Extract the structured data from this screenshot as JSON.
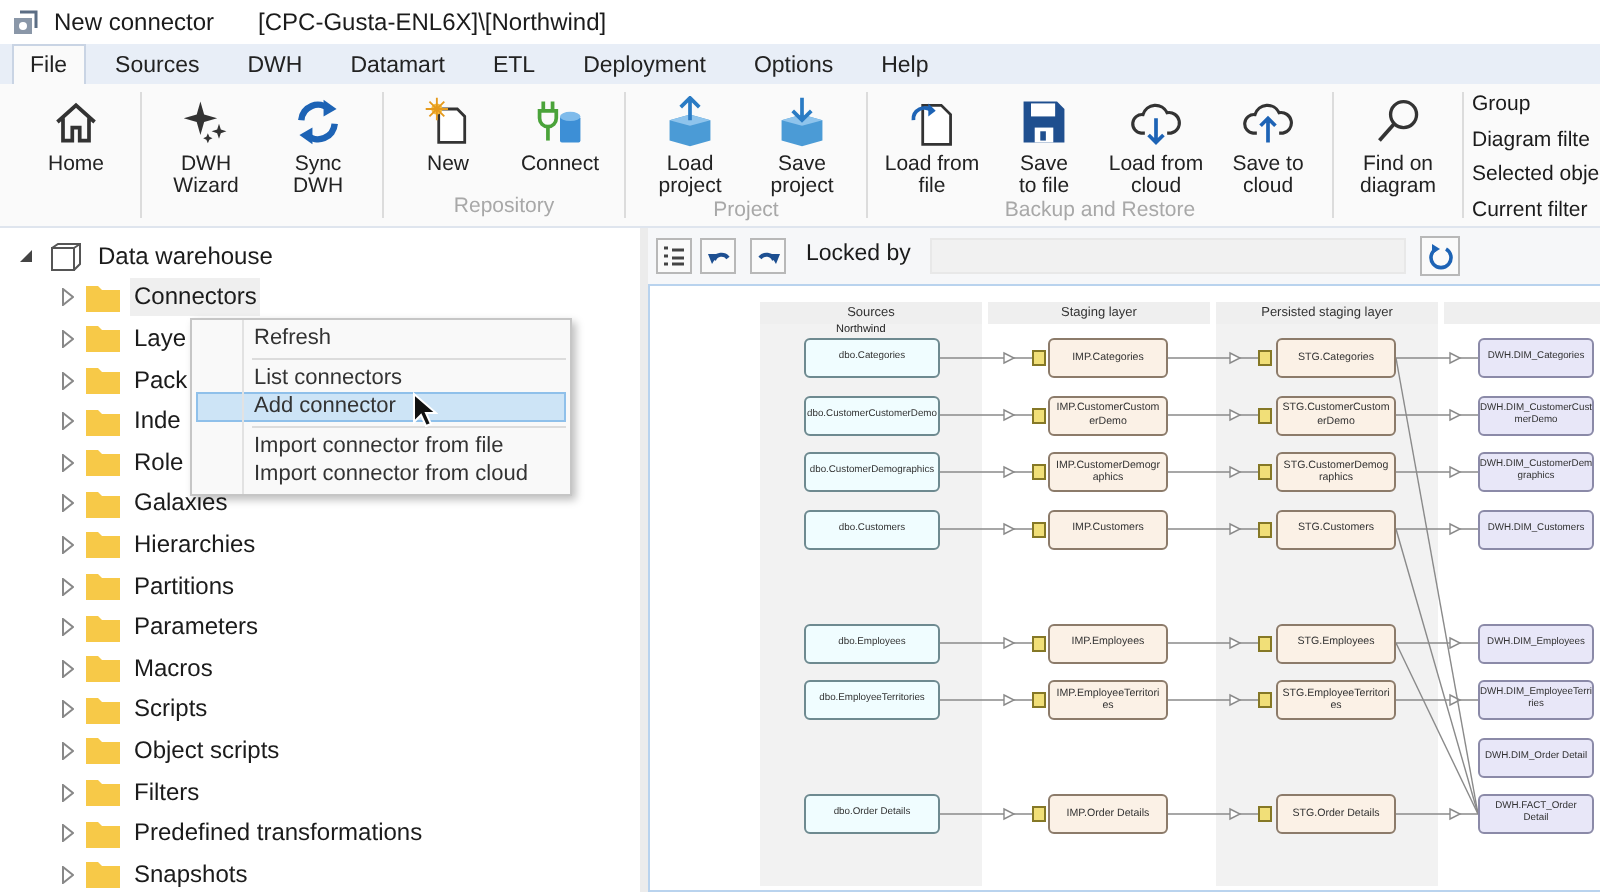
{
  "window": {
    "title": "New connector",
    "subtitle": "[CPC-Gusta-ENL6X]\\[Northwind]"
  },
  "ribbon_tabs": [
    {
      "label": "File",
      "selected": true
    },
    {
      "label": "Sources",
      "selected": false
    },
    {
      "label": "DWH",
      "selected": false
    },
    {
      "label": "Datamart",
      "selected": false
    },
    {
      "label": "ETL",
      "selected": false
    },
    {
      "label": "Deployment",
      "selected": false
    },
    {
      "label": "Options",
      "selected": false
    },
    {
      "label": "Help",
      "selected": false
    }
  ],
  "ribbon_groups": [
    {
      "buttons": [
        {
          "kind": "home",
          "label": "Home"
        }
      ]
    },
    {
      "buttons": [
        {
          "kind": "wizard",
          "label": "DWH\nWizard"
        },
        {
          "kind": "sync",
          "label": "Sync\nDWH"
        }
      ]
    },
    {
      "label": "Repository",
      "buttons": [
        {
          "kind": "new",
          "label": "New"
        },
        {
          "kind": "connect",
          "label": "Connect"
        }
      ]
    },
    {
      "label": "Project",
      "buttons": [
        {
          "kind": "load_project",
          "label": "Load\nproject"
        },
        {
          "kind": "save_project",
          "label": "Save\nproject"
        }
      ]
    },
    {
      "label": "Backup and Restore",
      "buttons": [
        {
          "kind": "load_file",
          "label": "Load from\nfile"
        },
        {
          "kind": "save_file",
          "label": "Save\nto file"
        },
        {
          "kind": "load_cloud",
          "label": "Load from\ncloud"
        },
        {
          "kind": "save_cloud",
          "label": "Save to\ncloud"
        }
      ]
    },
    {
      "buttons": [
        {
          "kind": "find",
          "label": "Find on\ndiagram"
        }
      ]
    }
  ],
  "ribbon_side_items": [
    "Group",
    "Diagram filte",
    "Selected obje",
    "Current filter"
  ],
  "tree": {
    "label": "Data warehouse",
    "expanded": true,
    "children": [
      {
        "label": "Connectors",
        "selected": true,
        "expanded": false
      },
      {
        "label": "Laye",
        "selected": false,
        "expanded": false
      },
      {
        "label": "Pack",
        "selected": false,
        "expanded": false
      },
      {
        "label": "Inde",
        "selected": false,
        "expanded": false
      },
      {
        "label": "Role",
        "selected": false,
        "expanded": false
      },
      {
        "label": "Galaxies",
        "selected": false,
        "expanded": false
      },
      {
        "label": "Hierarchies",
        "selected": false,
        "expanded": false
      },
      {
        "label": "Partitions",
        "selected": false,
        "expanded": false
      },
      {
        "label": "Parameters",
        "selected": false,
        "expanded": false
      },
      {
        "label": "Macros",
        "selected": false,
        "expanded": false
      },
      {
        "label": "Scripts",
        "selected": false,
        "expanded": false
      },
      {
        "label": "Object scripts",
        "selected": false,
        "expanded": false
      },
      {
        "label": "Filters",
        "selected": false,
        "expanded": false
      },
      {
        "label": "Predefined transformations",
        "selected": false,
        "expanded": false
      },
      {
        "label": "Snapshots",
        "selected": false,
        "expanded": false
      }
    ]
  },
  "context_menu": {
    "groups": [
      [
        {
          "label": "Refresh",
          "selected": false
        }
      ],
      [
        {
          "label": "List connectors",
          "selected": false
        },
        {
          "label": "Add connector",
          "selected": true
        }
      ],
      [
        {
          "label": "Import connector from file",
          "selected": false
        },
        {
          "label": "Import connector from cloud",
          "selected": false
        }
      ]
    ]
  },
  "diagram_toolbar": {
    "locked_by_label": "Locked by"
  },
  "diagram": {
    "columns": [
      "Sources",
      "Staging layer",
      "Persisted staging layer"
    ],
    "source_database": "Northwind",
    "rows": [
      {
        "source": "dbo.Categories",
        "staging": "IMP.Categories",
        "persisted": "STG.Categories",
        "dwh": "DWH.DIM_Categories",
        "feeds_fact": true
      },
      {
        "source": "dbo.CustomerCustomerDemo",
        "staging": "IMP.CustomerCustomerDemo",
        "persisted": "STG.CustomerCustomerDemo",
        "dwh": "DWH.DIM_CustomerCust merDemo"
      },
      {
        "source": "dbo.CustomerDemographics",
        "staging": "IMP.CustomerDemographics",
        "persisted": "STG.CustomerDemographics",
        "dwh": "DWH.DIM_CustomerDem graphics"
      },
      {
        "source": "dbo.Customers",
        "staging": "IMP.Customers",
        "persisted": "STG.Customers",
        "dwh": "DWH.DIM_Customers",
        "feeds_fact": true
      },
      {
        "source": "dbo.Employees",
        "staging": "IMP.Employees",
        "persisted": "STG.Employees",
        "dwh": "DWH.DIM_Employees",
        "gap_before": true,
        "feeds_fact": true
      },
      {
        "source": "dbo.EmployeeTerritories",
        "staging": "IMP.EmployeeTerritories",
        "persisted": "STG.EmployeeTerritories",
        "dwh": "DWH.DIM_EmployeeTerri ries"
      },
      {
        "dwh": "DWH.DIM_Order Detail"
      },
      {
        "source": "dbo.Order Details",
        "staging": "IMP.Order Details",
        "persisted": "STG.Order Details",
        "dwh": "DWH.FACT_Order Detail",
        "fact": true
      }
    ]
  }
}
